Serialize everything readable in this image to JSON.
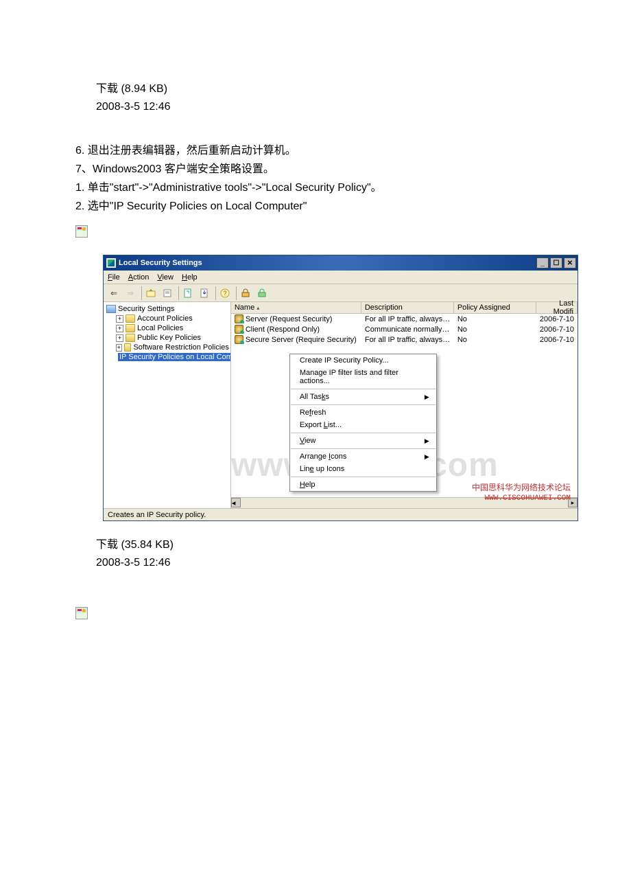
{
  "top": {
    "download": "下载",
    "size": "(8.94 KB)",
    "timestamp": "2008-3-5 12:46"
  },
  "steps": {
    "s6": "6. 退出注册表编辑器，然后重新启动计算机。",
    "s7": "7、Windows2003 客户端安全策略设置。",
    "s7_1": "1. 单击\"start\"->\"Administrative tools\"->\"Local Security Policy\"。",
    "s7_2": "2. 选中\"IP Security Policies on Local Computer\""
  },
  "window": {
    "title": "Local Security Settings",
    "menu": {
      "file": "File",
      "action": "Action",
      "view": "View",
      "help": "Help"
    },
    "tree": {
      "root": "Security Settings",
      "account": "Account Policies",
      "local": "Local Policies",
      "pubkey": "Public Key Policies",
      "software": "Software Restriction Policies",
      "ipsec": "IP Security Policies on Local Computer"
    },
    "columns": {
      "name": "Name",
      "desc": "Description",
      "pol": "Policy Assigned",
      "mod": "Last Modifi"
    },
    "rows": [
      {
        "name": "Server (Request Security)",
        "desc": "For all IP traffic, always req...",
        "pol": "No",
        "mod": "2006-7-10"
      },
      {
        "name": "Client (Respond Only)",
        "desc": "Communicate normally (uns...",
        "pol": "No",
        "mod": "2006-7-10"
      },
      {
        "name": "Secure Server (Require Security)",
        "desc": "For all IP traffic, always req...",
        "pol": "No",
        "mod": "2006-7-10"
      }
    ],
    "context_menu": {
      "create": "Create IP Security Policy...",
      "manage": "Manage IP filter lists and filter actions...",
      "alltasks": "All Tasks",
      "refresh": "Refresh",
      "export": "Export List...",
      "view": "View",
      "arrange": "Arrange Icons",
      "lineup": "Line up Icons",
      "help": "Help"
    },
    "status": "Creates an IP Security policy."
  },
  "watermark": {
    "main": "www.doocx.com",
    "cn": "中国思科华为网络技术论坛",
    "url": "WWW.CISCOHUAWEI.COM"
  },
  "bottom": {
    "download": "下载",
    "size": "(35.84 KB)",
    "timestamp": "2008-3-5 12:46"
  }
}
